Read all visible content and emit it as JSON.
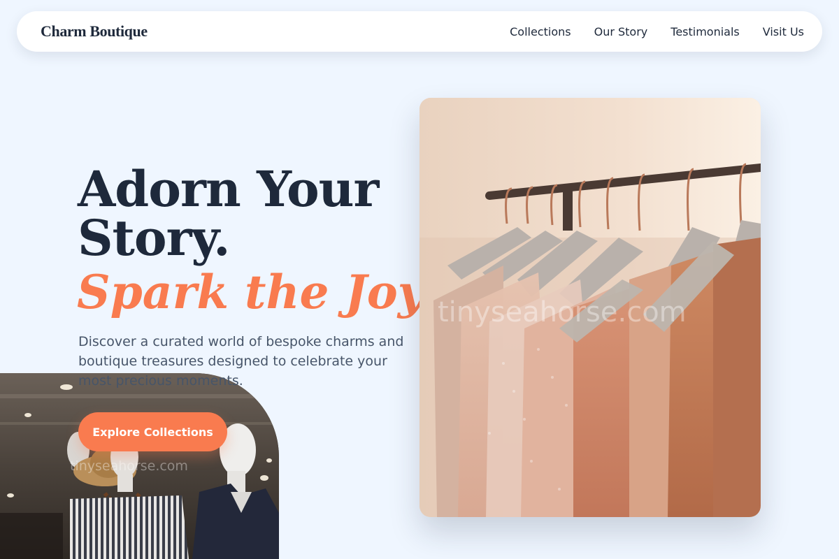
{
  "nav": {
    "brand": "Charm Boutique",
    "links": [
      "Collections",
      "Our Story",
      "Testimonials",
      "Visit Us"
    ]
  },
  "hero": {
    "title": "Adorn Your Story.",
    "accent": "Spark the Joy.",
    "description": "Discover a curated world of bespoke charms and boutique treasures designed to celebrate your most precious moments.",
    "cta_label": "Explore Collections"
  },
  "images": {
    "rack_watermark": "tinyseahorse.com",
    "mannequin_watermark": "tinyseahorse.com"
  },
  "colors": {
    "background": "#eff6ff",
    "accent": "#f97b4f",
    "text_dark": "#1e293b",
    "text_muted": "#475569"
  }
}
